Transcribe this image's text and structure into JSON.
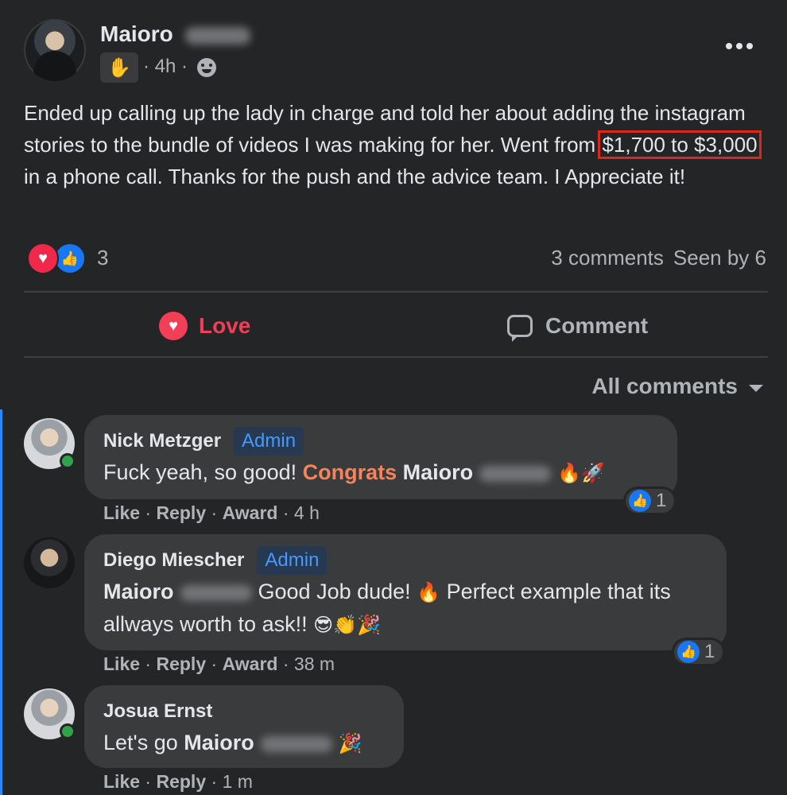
{
  "post": {
    "author": "Maioro",
    "badge_icon": "waving-hand-icon",
    "time": "· 4h ·",
    "privacy_icon": "group-icon",
    "text_before": "Ended up calling up the lady in charge and told her about adding the instagram stories to the bundle of videos I was making for her. Went from ",
    "text_highlight": "$1,700 to $3,000",
    "text_after": " in a phone call. Thanks for the push and the advice team. I Appreciate it!",
    "highlight_color": "#e0261b",
    "reaction_count": "3",
    "comments_count": "3 comments",
    "seen_by": "Seen by 6"
  },
  "actions": {
    "love_label": "Love",
    "comment_label": "Comment",
    "love_color": "#f33e58"
  },
  "sort_label": "All comments",
  "comments": [
    {
      "name": "Nick Metzger",
      "badge": "Admin",
      "text_a": "Fuck yeah, so good! ",
      "text_highlight": "Congrats",
      "text_mention": " Maioro",
      "emojis": "🔥🚀",
      "like": "Like",
      "reply": "Reply",
      "award": "Award",
      "time": "4 h",
      "reactions": "1",
      "online": true
    },
    {
      "name": "Diego Miescher",
      "badge": "Admin",
      "mention": "Maioro",
      "text_a": "Good Job dude! ",
      "emoji_mid": "🔥",
      "text_b": " Perfect example that its allways worth to ask!! ",
      "emojis": "😎👏🎉",
      "like": "Like",
      "reply": "Reply",
      "award": "Award",
      "time": "38 m",
      "reactions": "1",
      "online": false
    },
    {
      "name": "Josua Ernst",
      "text_a": "Let's go ",
      "mention": "Maioro",
      "emojis": "🎉",
      "like": "Like",
      "reply": "Reply",
      "time": "1 m",
      "online": true
    }
  ]
}
